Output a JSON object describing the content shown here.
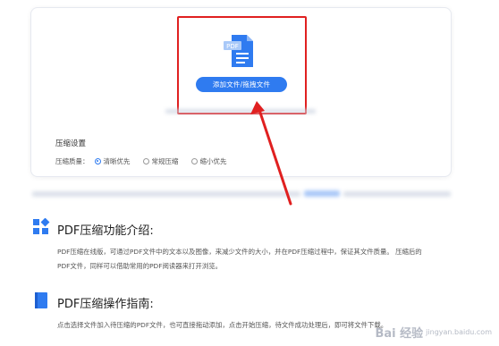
{
  "upload": {
    "file_badge": "PDF",
    "add_button_label": "添加文件/拖拽文件"
  },
  "settings": {
    "title": "压缩设置",
    "quality_label": "压缩质量：",
    "options": [
      {
        "label": "清晰优先",
        "selected": true
      },
      {
        "label": "常规压缩",
        "selected": false
      },
      {
        "label": "缩小优先",
        "selected": false
      }
    ]
  },
  "intro": {
    "title": "PDF压缩功能介绍:",
    "text_line1": "PDF压缩在线版，可通过PDF文件中的文本以及图像，来减少文件的大小，并在PDF压缩过程中，保证其文件质量。 压缩后的",
    "text_line2": "PDF文件，同样可以借助常用的PDF阅读器来打开浏览。"
  },
  "guide": {
    "title": "PDF压缩操作指南:",
    "text_line1": "点击选择文件加入待压缩的PDF文件，也可直接拖动添加，点击开始压缩，待文件成功处理后，即可将文件下载。"
  },
  "watermark": {
    "brand": "Bai 经验",
    "sub": "jingyan.baidu.com"
  },
  "colors": {
    "accent": "#2f7bf0",
    "annotation": "#e02020"
  }
}
